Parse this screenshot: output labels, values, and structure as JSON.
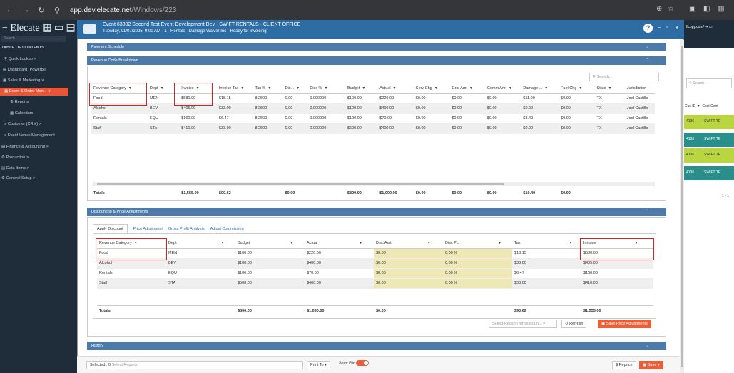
{
  "browser": {
    "url_host": "app.dev.elecate.net",
    "url_path": "/Windows/223"
  },
  "sidebar": {
    "logo": "Elecate",
    "search_placeholder": "Search",
    "toc": "TABLE OF CONTENTS",
    "items": [
      "Quick Lookup  >",
      "Dashboard (PowerBI)",
      "Sales & Marketing  ∨",
      "Event & Order Man...  ∨",
      "Reports",
      "Calendars",
      "Customer (CRM)  >",
      "Event Venue Management",
      "Finance & Accounting  >",
      "Production  >",
      "Data Items  >",
      "General Setup  >"
    ]
  },
  "background": {
    "email_fragment": "ficopy.com/",
    "search": "Search",
    "col1": "Cus ID",
    "col2": "Cost Cent",
    "rows": [
      "4136",
      "4136",
      "4136",
      "4136"
    ],
    "row_value": "SWIFT TE",
    "pager": "1 - 1"
  },
  "modal": {
    "title": "Event 63802 Second Test Event Development Dev - SWIFT RENTALS - CLIENT OFFICE",
    "subtitle": "Tuesday, 01/07/2025, 9:00 AM - 1 - Rentals - Damage Waiver Inc - Ready for invoicing",
    "help": "?"
  },
  "sections": {
    "payment": "Payment Schedule",
    "revenue": "Revenue Code Breakdown",
    "discount": "Discounting & Price Adjustments",
    "history": "History"
  },
  "revenue": {
    "search_placeholder": "Search...",
    "columns": [
      "Revenue Category",
      "Dept",
      "Invoice",
      "Invoice Tax",
      "Tax %",
      "Dis...",
      "Disc %",
      "Budget",
      "Actual",
      "Serv Chg",
      "Grat Amt",
      "Comm Amt",
      "Damage ...",
      "Fuel Chg",
      "State",
      "Jurisdiction"
    ],
    "rows": [
      [
        "Food",
        "MEN",
        "$580.00",
        "$18.15",
        "8.2500",
        "0.00",
        "0.000000",
        "$100.00",
        "$220.00",
        "$0.00",
        "$0.00",
        "$0.00",
        "$11.00",
        "$0.00",
        "TX",
        "Joel Castillo"
      ],
      [
        "Alcohol",
        "BEV",
        "$405.00",
        "$33.00",
        "8.2500",
        "0.00",
        "0.000000",
        "$100.00",
        "$400.00",
        "$0.00",
        "$0.00",
        "$0.00",
        "$0.00",
        "$0.00",
        "TX",
        "Joel Castillo"
      ],
      [
        "Rentals",
        "EQU",
        "$160.00",
        "$6.47",
        "8.2500",
        "0.00",
        "0.000000",
        "$100.00",
        "$70.00",
        "$0.00",
        "$0.00",
        "$0.00",
        "$8.40",
        "$0.00",
        "TX",
        "Joel Castillo"
      ],
      [
        "Staff",
        "STA",
        "$410.00",
        "$33.00",
        "8.2500",
        "0.00",
        "0.000000",
        "$500.00",
        "$400.00",
        "$0.00",
        "$0.00",
        "$0.00",
        "$0.00",
        "$0.00",
        "TX",
        "Joel Castillo"
      ]
    ],
    "totals": [
      "Totals",
      "",
      "$1,555.00",
      "$90.62",
      "",
      "$0.00",
      "",
      "$800.00",
      "$1,090.00",
      "$0.00",
      "$0.00",
      "$0.00",
      "$19.40",
      "$0.00",
      "",
      ""
    ]
  },
  "discount": {
    "tabs": [
      "Apply Discount",
      "Price Adjustment",
      "Gross Profit Analysis",
      "Adjust Commission"
    ],
    "columns": [
      "Revenue Category",
      "Dept",
      "Budget",
      "Actual",
      "Disc Amt",
      "Disc Pct",
      "Tax",
      "Invoice"
    ],
    "rows": [
      [
        "Food",
        "MEN",
        "$100.00",
        "$220.00",
        "$0.00",
        "0.00 %",
        "$18.15",
        "$580.00"
      ],
      [
        "Alcohol",
        "BEV",
        "$100.00",
        "$400.00",
        "$0.00",
        "0.00 %",
        "$33.00",
        "$405.00"
      ],
      [
        "Rentals",
        "EQU",
        "$100.00",
        "$70.00",
        "$0.00",
        "0.00 %",
        "$6.47",
        "$160.00"
      ],
      [
        "Staff",
        "STA",
        "$500.00",
        "$400.00",
        "$0.00",
        "0.00 %",
        "$33.00",
        "$410.00"
      ]
    ],
    "totals": [
      "Totals",
      "",
      "$800.00",
      "$1,090.00",
      "$0.00",
      "",
      "$90.62",
      "$1,555.00"
    ],
    "reason_placeholder": "Select Reason for Discoun...",
    "refresh": "Refresh",
    "save": "Save Price Adjustments"
  },
  "footer": {
    "selected": "Selected : 0",
    "select_reports": "Select Reports",
    "print_to": "Print To",
    "save_file": "Save File",
    "reprice": "$ Reprice",
    "save": "Save"
  }
}
